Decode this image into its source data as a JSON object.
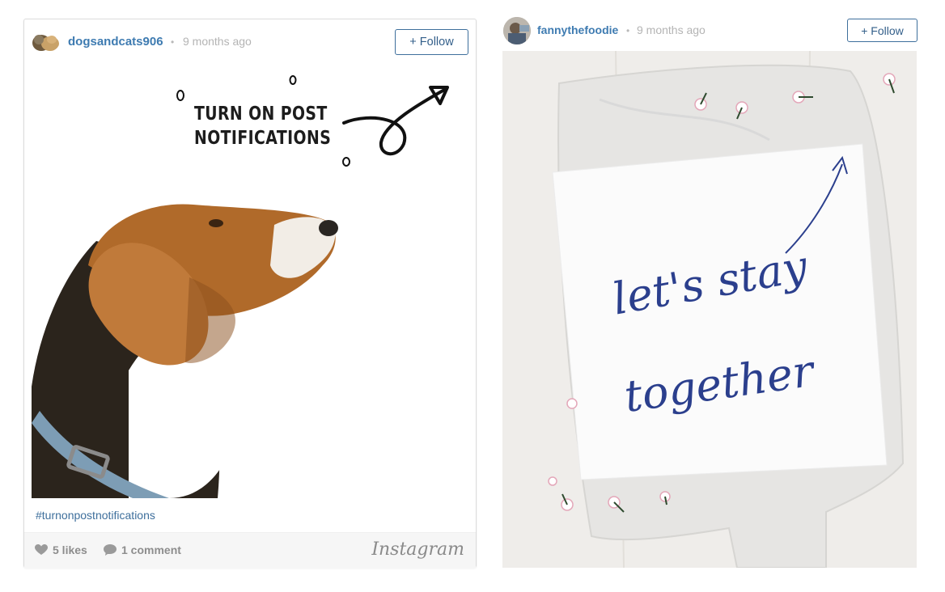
{
  "posts": [
    {
      "username": "dogsandcats906",
      "separator": "•",
      "time": "9 months ago",
      "follow_label": "+ Follow",
      "image_text": [
        "TURN ON POST",
        "NOTIFICATIONS"
      ],
      "caption": "#turnonpostnotifications",
      "likes": "5 likes",
      "comments": "1 comment",
      "brand": "Instagram"
    },
    {
      "username": "fannythefoodie",
      "separator": "•",
      "time": "9 months ago",
      "follow_label": "+ Follow",
      "image_text": [
        "let's stay",
        "together"
      ]
    }
  ],
  "colors": {
    "link": "#3e7bb1",
    "button_border": "#3e6f9c",
    "meta_gray": "#8d8d8d",
    "ink_blue": "#2b3f8d"
  }
}
